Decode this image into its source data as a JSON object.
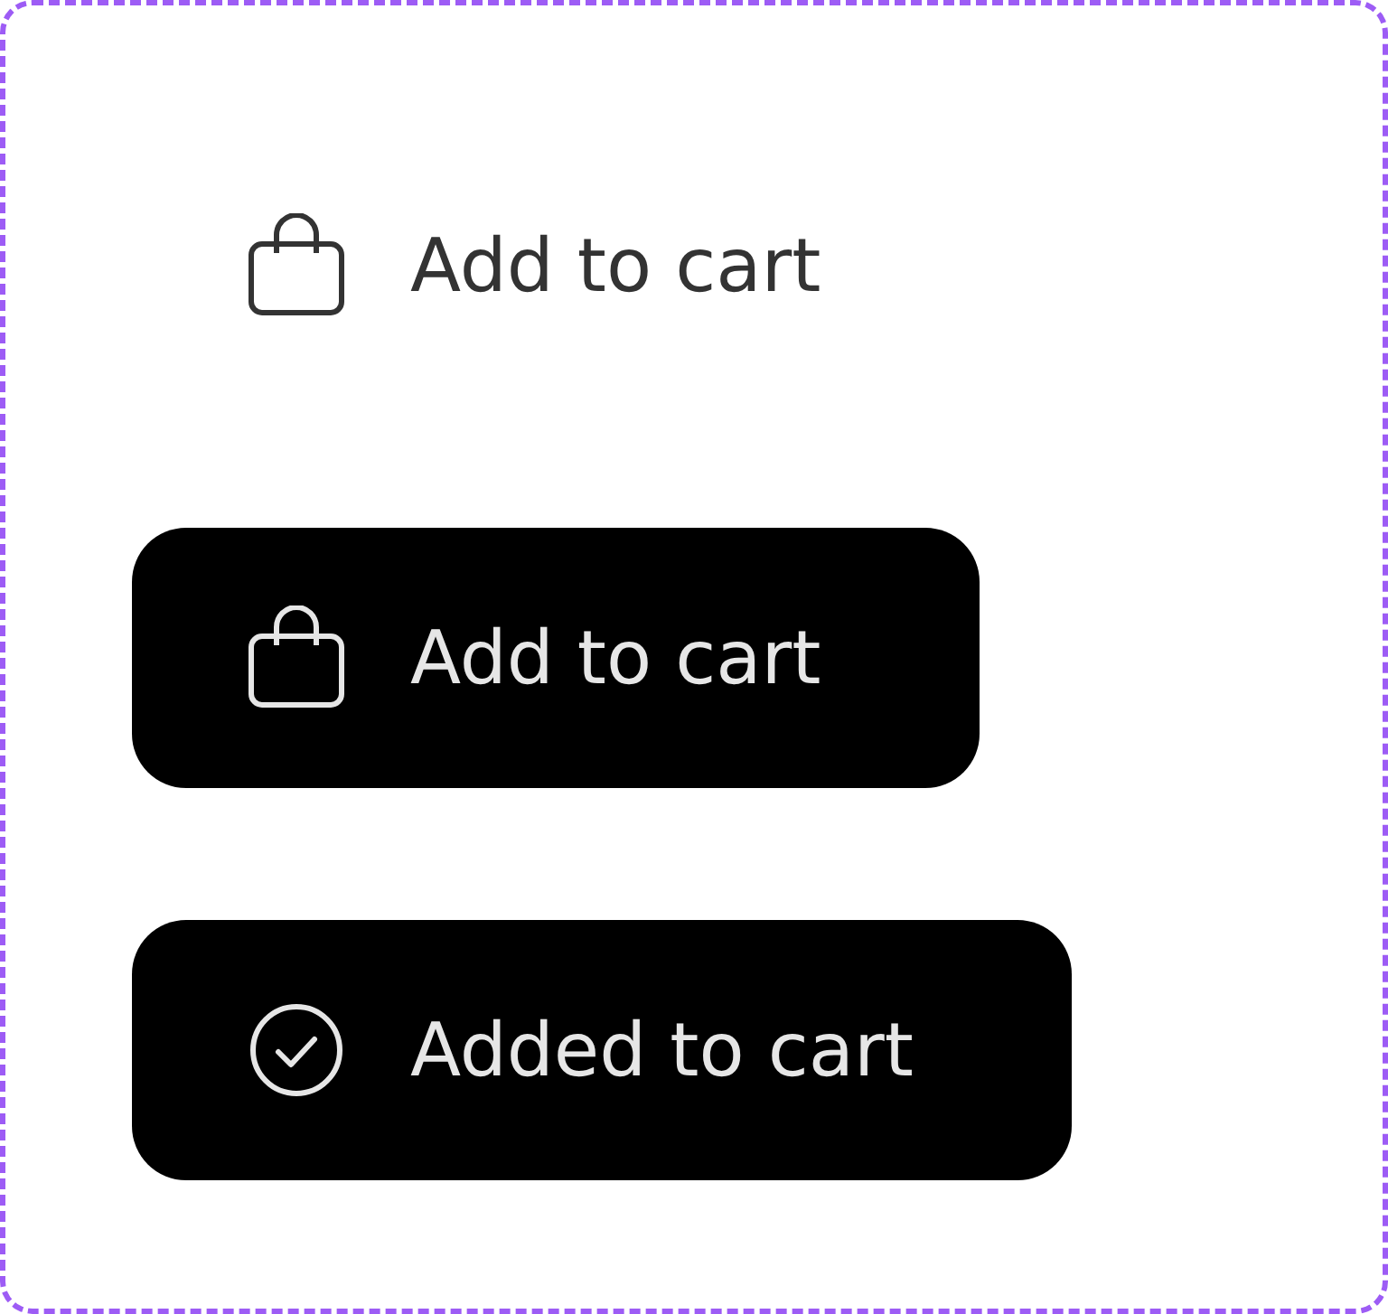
{
  "buttons": [
    {
      "kind": "ghost",
      "label": "Add to cart",
      "added": false
    },
    {
      "kind": "solid",
      "label": "Add to cart",
      "added": false
    },
    {
      "kind": "solid",
      "label": "Added to cart",
      "added": true
    }
  ]
}
